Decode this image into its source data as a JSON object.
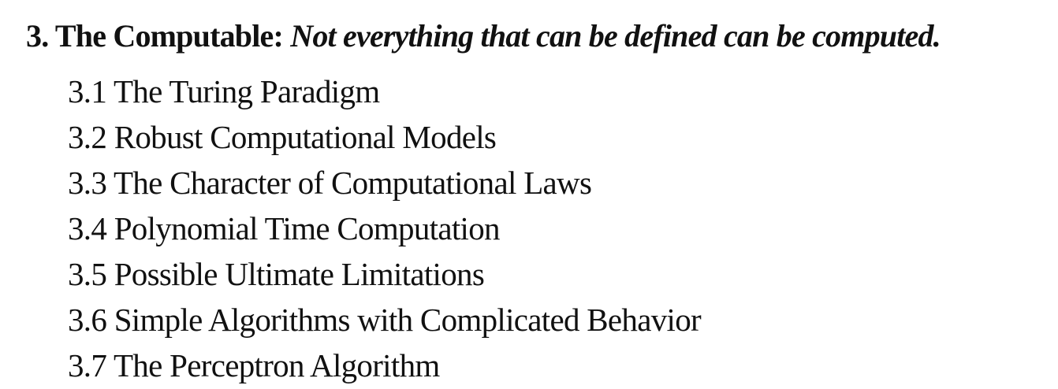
{
  "chapter": {
    "number": "3.",
    "title": "The Computable:",
    "tagline": "Not everything that can be defined can be computed."
  },
  "sections": [
    {
      "label": "3.1 The Turing Paradigm"
    },
    {
      "label": "3.2 Robust Computational Models"
    },
    {
      "label": "3.3 The Character of Computational Laws"
    },
    {
      "label": "3.4 Polynomial Time Computation"
    },
    {
      "label": "3.5 Possible Ultimate Limitations"
    },
    {
      "label": "3.6 Simple Algorithms with Complicated Behavior"
    },
    {
      "label": "3.7 The Perceptron Algorithm"
    }
  ]
}
